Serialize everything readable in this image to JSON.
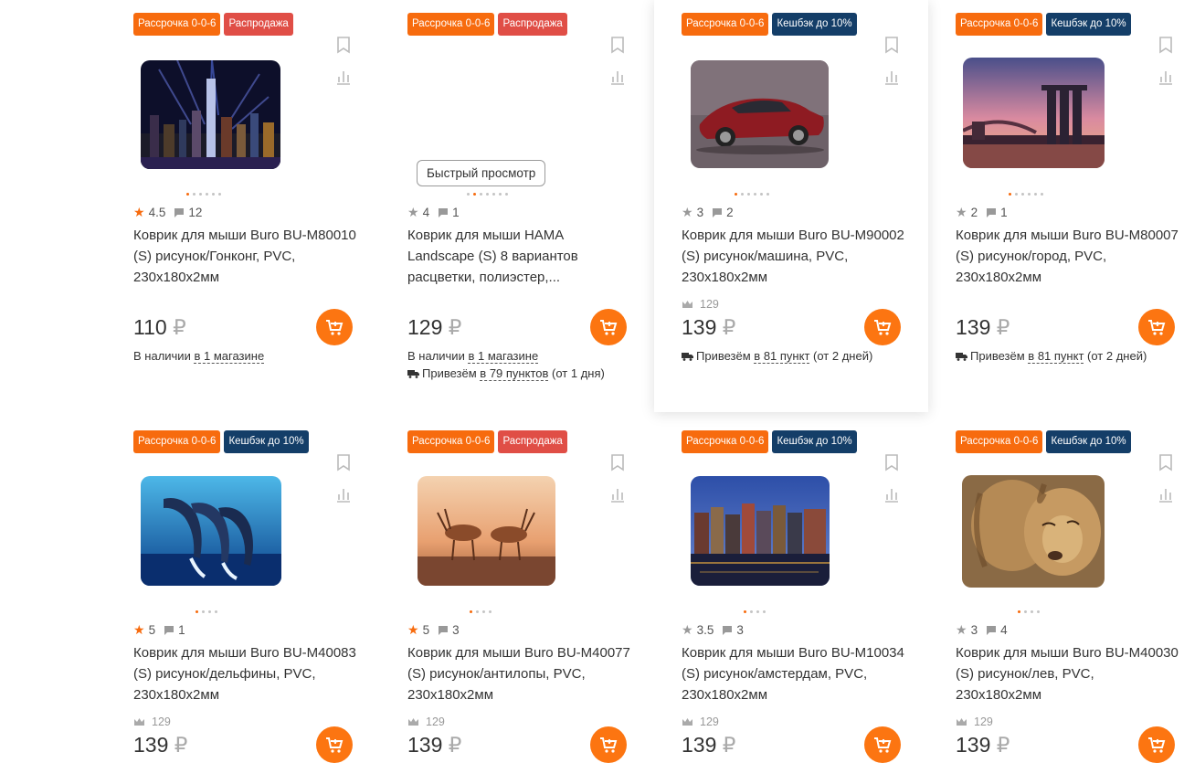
{
  "common": {
    "currency": "₽",
    "quick_view": "Быстрый просмотр",
    "in_stock": "В наличии",
    "deliver": "Привезём"
  },
  "colors": {
    "accent": "#f76b0e",
    "sale": "#e04e46",
    "cashback": "#143e68"
  },
  "products": [
    {
      "badges": [
        {
          "text": "Рассрочка 0-0-6",
          "color": "orange"
        },
        {
          "text": "Распродажа",
          "color": "red"
        }
      ],
      "image": "hong-kong-night-skyline",
      "rating": "4.5",
      "rating_gold": true,
      "reviews": "12",
      "title": "Коврик для мыши Buro BU-M80010 (S) рисунок/Гонконг, PVC, 230x180x2мм",
      "price": "110",
      "availability": {
        "prefix": "",
        "link": "в 1 магазине"
      }
    },
    {
      "badges": [
        {
          "text": "Рассрочка 0-0-6",
          "color": "orange"
        },
        {
          "text": "Распродажа",
          "color": "red"
        }
      ],
      "image": "",
      "rating": "4",
      "rating_gold": false,
      "reviews": "1",
      "title": "Коврик для мыши HAMA Landscape (S) 8 вариантов расцветки, полиэстер,...",
      "price": "129",
      "availability": {
        "prefix": "",
        "link": "в 1 магазине"
      },
      "delivery": {
        "link": "в 79 пунктов",
        "suffix": "(от 1 дня)"
      }
    },
    {
      "badges": [
        {
          "text": "Рассрочка 0-0-6",
          "color": "orange"
        },
        {
          "text": "Кешбэк до 10%",
          "color": "navy"
        }
      ],
      "image": "red-car",
      "rating": "3",
      "rating_gold": false,
      "reviews": "2",
      "title": "Коврик для мыши Buro BU-M90002 (S) рисунок/машина, PVC, 230x180x2мм",
      "buyers": "129",
      "price": "139",
      "delivery": {
        "link": "в 81 пункт",
        "suffix": "(от 2 дней)"
      }
    },
    {
      "badges": [
        {
          "text": "Рассрочка 0-0-6",
          "color": "orange"
        },
        {
          "text": "Кешбэк до 10%",
          "color": "navy"
        }
      ],
      "image": "city-sunset",
      "rating": "2",
      "rating_gold": false,
      "reviews": "1",
      "title": "Коврик для мыши Buro BU-M80007 (S) рисунок/город, PVC, 230x180x2мм",
      "price": "139",
      "delivery": {
        "link": "в 81 пункт",
        "suffix": "(от 2 дней)"
      }
    },
    {
      "badges": [
        {
          "text": "Рассрочка 0-0-6",
          "color": "orange"
        },
        {
          "text": "Кешбэк до 10%",
          "color": "navy"
        }
      ],
      "image": "dolphins",
      "rating": "5",
      "rating_gold": true,
      "reviews": "1",
      "title": "Коврик для мыши Buro BU-M40083 (S) рисунок/дельфины, PVC, 230x180x2мм",
      "buyers": "129",
      "price": "139"
    },
    {
      "badges": [
        {
          "text": "Рассрочка 0-0-6",
          "color": "orange"
        },
        {
          "text": "Распродажа",
          "color": "red"
        }
      ],
      "image": "antelopes",
      "rating": "5",
      "rating_gold": true,
      "reviews": "3",
      "title": "Коврик для мыши Buro BU-M40077 (S) рисунок/антилопы, PVC, 230x180x2мм",
      "buyers": "129",
      "price": "139"
    },
    {
      "badges": [
        {
          "text": "Рассрочка 0-0-6",
          "color": "orange"
        },
        {
          "text": "Кешбэк до 10%",
          "color": "navy"
        }
      ],
      "image": "amsterdam",
      "rating": "3.5",
      "rating_gold": false,
      "reviews": "3",
      "title": "Коврик для мыши Buro BU-M10034 (S) рисунок/амстердам, PVC, 230x180x2мм",
      "buyers": "129",
      "price": "139"
    },
    {
      "badges": [
        {
          "text": "Рассрочка 0-0-6",
          "color": "orange"
        },
        {
          "text": "Кешбэк до 10%",
          "color": "navy"
        }
      ],
      "image": "lion",
      "rating": "3",
      "rating_gold": false,
      "reviews": "4",
      "title": "Коврик для мыши Buro BU-M40030 (S) рисунок/лев, PVC, 230x180x2мм",
      "buyers": "129",
      "price": "139"
    }
  ]
}
